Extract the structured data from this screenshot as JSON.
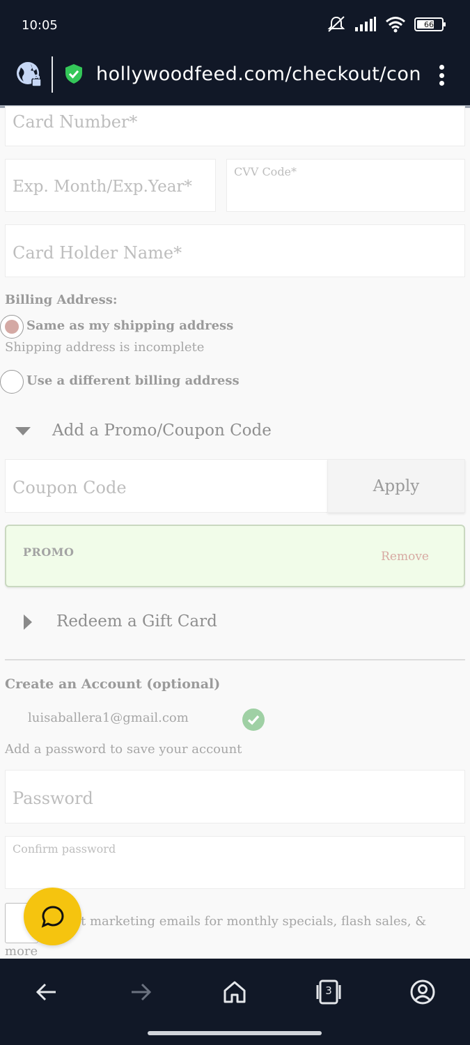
{
  "status_bar": {
    "time": "10:05",
    "battery": "66"
  },
  "browser": {
    "url": "hollywoodfeed.com/checkout/conf"
  },
  "payment": {
    "card_number_placeholder": "Card Number*",
    "exp_placeholder": "Exp. Month/Exp.Year*",
    "cvv_placeholder": "CVV Code*",
    "card_holder_placeholder": "Card Holder Name*"
  },
  "billing": {
    "heading": "Billing Address:",
    "same_as_shipping_label": "Same as my shipping address",
    "same_as_shipping_selected": true,
    "shipping_incomplete_note": "Shipping address is incomplete",
    "different_billing_label": "Use a different billing address"
  },
  "promo": {
    "toggle_label": "Add a Promo/Coupon Code",
    "coupon_placeholder": "Coupon Code",
    "apply_label": "Apply",
    "applied_code": "PROMO",
    "remove_label": "Remove"
  },
  "gift_card": {
    "toggle_label": "Redeem a Gift Card"
  },
  "account": {
    "heading": "Create an Account (optional)",
    "email": "luisaballera1@gmail.com",
    "password_hint": "Add a password to save your account",
    "password_placeholder": "Password",
    "confirm_placeholder": "Confirm password",
    "marketing_text_line1": "t marketing emails for monthly specials, flash sales, &",
    "marketing_text_line2": "more"
  },
  "bottom_nav": {
    "tabs_count": "3"
  },
  "colors": {
    "chrome_bg": "#111827",
    "promo_bg": "#f1fce9",
    "radio_selected": "#d4a9a4",
    "check_green": "#9fd0a4",
    "chat_fab": "#f5c40f",
    "remove_link": "#d7a9a2"
  }
}
